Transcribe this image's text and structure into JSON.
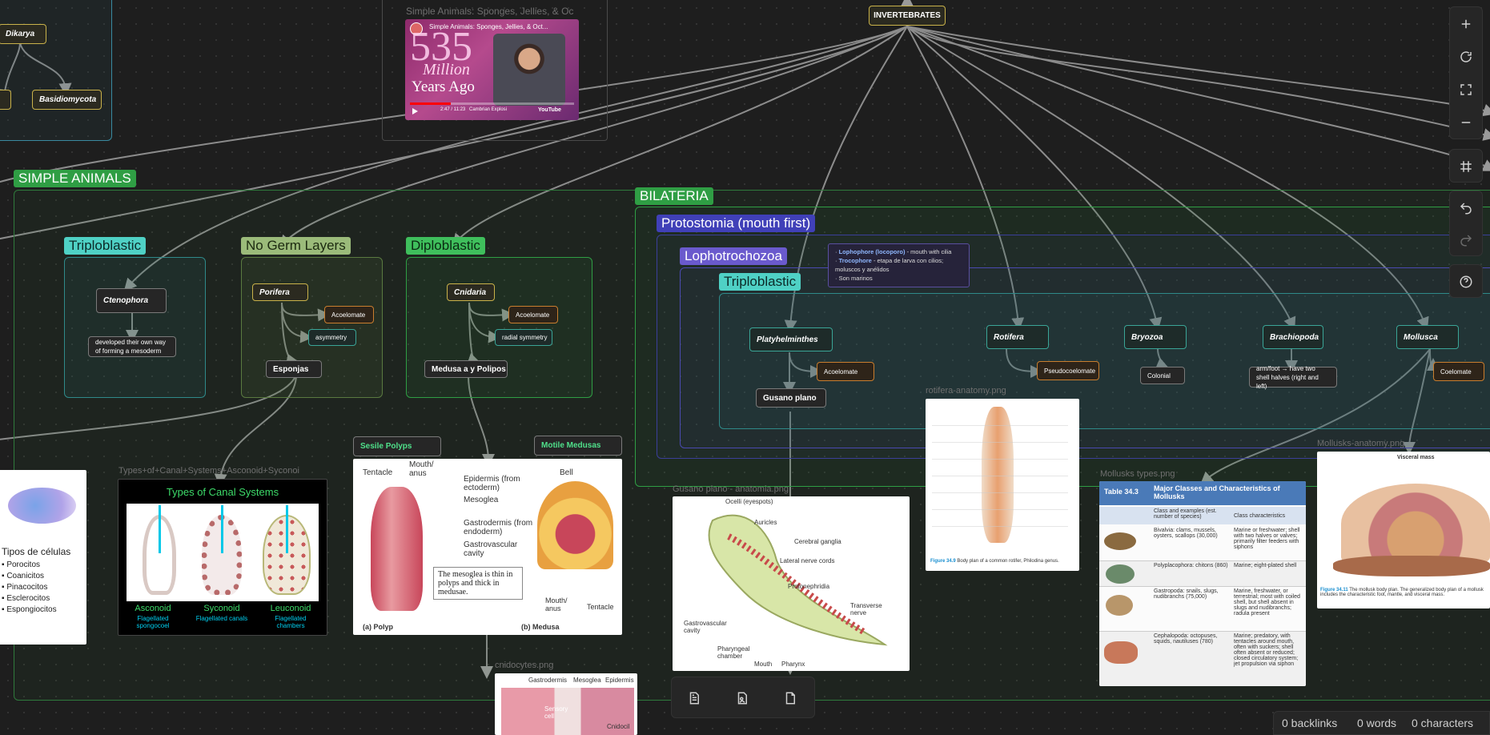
{
  "top_root": {
    "label": "INVERTEBRATES"
  },
  "fungi": {
    "dikarya": "Dikarya",
    "basidiomycota": "Basidiomycota"
  },
  "video": {
    "caption": "Simple Animals: Sponges, Jellies, & Oc",
    "title": "Simple Animals: Sponges, Jellies, & Oct...",
    "big_number": "535",
    "million": "Million",
    "years_ago": "Years Ago",
    "time": "2:47 / 11:23",
    "channel": "Cambrian Explosi",
    "youtube": "YouTube"
  },
  "groups": {
    "simple_animals": "SIMPLE ANIMALS",
    "bilateria": "BILATERIA",
    "protostomia": "Protostomia (mouth first)",
    "lophotrochozoa": "Lophotrochozoa",
    "triploblastic_inner": "Triploblastic",
    "triploblastic": "Triploblastic",
    "no_germ_layers": "No Germ Layers",
    "diploblastic": "Diploblastic"
  },
  "nodes": {
    "ctenophora": "Ctenophora",
    "ctenophora_note": "developed their own way of forming a mesoderm",
    "porifera": "Porifera",
    "porifera_acoelomate": "Acoelomate",
    "porifera_asymmetry": "asymmetry",
    "esponjas": "Esponjas",
    "cnidaria": "Cnidaria",
    "cnidaria_acoelomate": "Acoelomate",
    "cnidaria_radial": "radial symmetry",
    "medusa": "Medusa a y Polipos",
    "platyhelminthes": "Platyhelminthes",
    "platy_acoelomate": "Acoelomate",
    "gusano_plano": "Gusano plano",
    "rotifera": "Rotifera",
    "pseudocoelomate": "Pseudocoelomate",
    "bryozoa": "Bryozoa",
    "colonial": "Colonial",
    "brachiopoda": "Brachiopoda",
    "brachiopoda_note": "arm/foot → have two shell halves (right and left)",
    "mollusca": "Mollusca",
    "coelomate": "Coelomate",
    "sesile": "Sesile Polyps",
    "motile": "Motile Medusas"
  },
  "lopho_note": {
    "line1_key": "Lophophore (locoporo)",
    "line1_rest": " - mouth with cilia",
    "line2_key": "Trocophore",
    "line2_rest": " - etapa de larva con cilios; moluscos y anélidos",
    "line3": "Son marinos"
  },
  "images": {
    "canal_label": "Types+of+Canal+Systems+Asconoid+Syconoi",
    "canal_title": "Types of Canal Systems",
    "asconoid": "Asconoid",
    "asconoid_sub": "Flagellated spongocoel",
    "syconoid": "Syconoid",
    "syconoid_sub": "Flagellated canals",
    "leuconoid": "Leuconoid",
    "leuconoid_sub": "Flagellated chambers",
    "cells_title": "Tipos de células",
    "cells": [
      "Porocitos",
      "Coanicitos",
      "Pinacocitos",
      "Esclerocitos",
      "Espongiocitos"
    ],
    "polyp_tentacle": "Tentacle",
    "polyp_mouth": "Mouth/ anus",
    "polyp_epidermis": "Epidermis (from ectoderm)",
    "polyp_mesoglea": "Mesoglea",
    "polyp_gastrodermis": "Gastrodermis (from endoderm)",
    "polyp_cavity": "Gastrovascular cavity",
    "polyp_bell": "Bell",
    "polyp_note": "The mesoglea is thin in polyps and thick in medusae.",
    "polyp_a": "(a) Polyp",
    "polyp_b": "(b) Medusa",
    "medusa_mouth": "Mouth/ anus",
    "medusa_tentacle": "Tentacle",
    "gusano_label": "Gusano plano - anatomia.png",
    "gusano_labels": [
      "Ocelli (eyespots)",
      "Auricles",
      "Cerebral ganglia",
      "Lateral nerve cords",
      "Protonephridia",
      "Transverse nerve",
      "Gastrovascular cavity",
      "Pharyngeal chamber",
      "Mouth",
      "Pharynx"
    ],
    "rotifera_label": "rotifera-anatomy.png",
    "rotifera_caption_key": "Figure 34.9",
    "rotifera_caption": "Body plan of a common rotifer, Philodina genus.",
    "mollusk_types_label": "Mollusks types.png",
    "table_id": "Table 34.3",
    "table_title": "Major Classes and Characteristics of Mollusks",
    "table_col1": "Class and examples (est. number of species)",
    "table_col2": "Class characteristics",
    "table_rows": [
      {
        "c1": "Bivalvia: clams, mussels, oysters, scallops (30,000)",
        "c2": "Marine or freshwater; shell with two halves or valves; primarily filter feeders with siphons"
      },
      {
        "c1": "Polyplacophora: chitons (860)",
        "c2": "Marine; eight-plated shell"
      },
      {
        "c1": "Gastropoda: snails, slugs, nudibranchs (75,000)",
        "c2": "Marine, freshwater, or terrestrial; most with coiled shell, but shell absent in slugs and nudibranchs; radula present"
      },
      {
        "c1": "Cephalopoda: octopuses, squids, nautiluses (780)",
        "c2": "Marine; predatory, with tentacles around mouth, often with suckers; shell often absent or reduced; closed circulatory system; jet propulsion via siphon"
      }
    ],
    "mollusk_anatomy_label": "Mollusks-anatomy.png",
    "mollusk_visceral": "Visceral mass",
    "mollusk_caption_key": "Figure 34.11",
    "mollusk_caption": "The mollusk body plan. The generalized body plan of a mollusk includes the characteristic foot, mantle, and visceral mass.",
    "cnido_label": "cnidocytes.png",
    "cnido_labels": [
      "Gastrodermis",
      "Mesoglea",
      "Epidermis",
      "Sensory cell",
      "Cnidocil"
    ]
  },
  "status": {
    "backlinks": "0 backlinks",
    "words": "0 words",
    "characters": "0 characters"
  },
  "colors": {
    "accent_green": "#2f9e44",
    "accent_blue": "#4d4dc7",
    "accent_cyan": "#4fd1c5"
  }
}
